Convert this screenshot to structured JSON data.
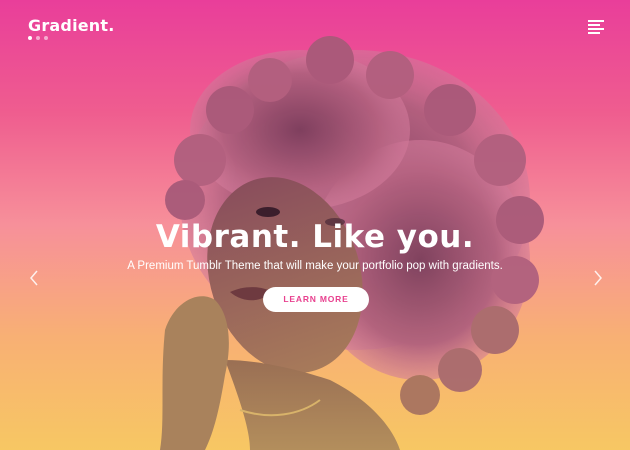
{
  "brand": {
    "name": "Gradient."
  },
  "slides": {
    "dots": [
      true,
      false,
      false
    ],
    "accent_color": "#e8418f",
    "gradient_top": "#e93e9a",
    "gradient_bottom": "#f7c763"
  },
  "hero": {
    "headline": "Vibrant. Like you.",
    "subline": "A Premium Tumblr Theme that will make your portfolio pop with gradients.",
    "cta_label": "LEARN MORE"
  },
  "icons": {
    "menu": "hamburger-menu-icon",
    "prev": "chevron-left-icon",
    "next": "chevron-right-icon"
  }
}
